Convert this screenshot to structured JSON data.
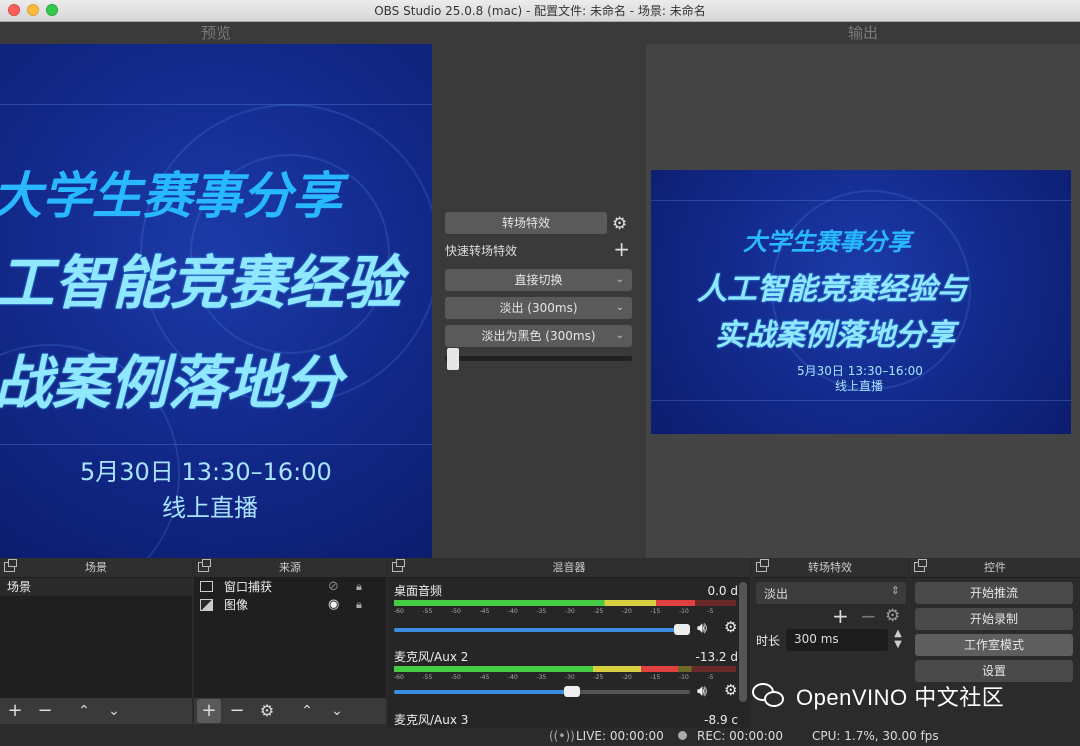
{
  "window": {
    "title": "OBS Studio 25.0.8 (mac) - 配置文件: 未命名 - 场景: 未命名"
  },
  "preview": {
    "label": "预览",
    "line1": "大学生赛事分享",
    "line2": "工智能竞赛经验",
    "line3": "战案例落地分",
    "date": "5月30日 13:30–16:00",
    "live": "线上直播"
  },
  "output": {
    "label": "输出",
    "line1": "大学生赛事分享",
    "line2": "人工智能竞赛经验与",
    "line3": "实战案例落地分享",
    "date": "5月30日 13:30–16:00",
    "live": "线上直播"
  },
  "transitions_panel": {
    "transition_button": "转场特效",
    "quick_label": "快速转场特效",
    "items": [
      "直接切换",
      "淡出 (300ms)",
      "淡出为黑色 (300ms)"
    ]
  },
  "docks": {
    "scenes": {
      "title": "场景",
      "items": [
        "场景"
      ]
    },
    "sources": {
      "title": "来源",
      "items": [
        {
          "label": "窗口捕获"
        },
        {
          "label": "图像"
        }
      ]
    },
    "mixer": {
      "title": "混音器",
      "scale": [
        "-60",
        "-55",
        "-50",
        "-45",
        "-40",
        "-35",
        "-30",
        "-25",
        "-20",
        "-15",
        "-10",
        "-5"
      ],
      "channels": [
        {
          "name": "桌面音频",
          "db": "0.0 d",
          "level": 0.88,
          "volume": 1.0
        },
        {
          "name": "麦克风/Aux 2",
          "db": "-13.2 d",
          "level": 0.83,
          "volume": 0.6
        },
        {
          "name": "麦克风/Aux 3",
          "db": "-8.9 c"
        }
      ]
    },
    "transitions": {
      "title": "转场特效",
      "selected": "淡出",
      "duration_label": "时长",
      "duration_value": "300 ms"
    },
    "controls": {
      "title": "控件",
      "buttons": [
        "开始推流",
        "开始录制",
        "工作室模式",
        "设置"
      ]
    }
  },
  "status": {
    "live": "LIVE: 00:00:00",
    "rec": "REC: 00:00:00",
    "cpu": "CPU: 1.7%, 30.00 fps"
  },
  "watermark": {
    "text": "OpenVINO 中文社区"
  },
  "colors": {
    "accent": "#3a8de0",
    "poster_bg": "#132a8c",
    "poster_title": "#28b8ff"
  }
}
